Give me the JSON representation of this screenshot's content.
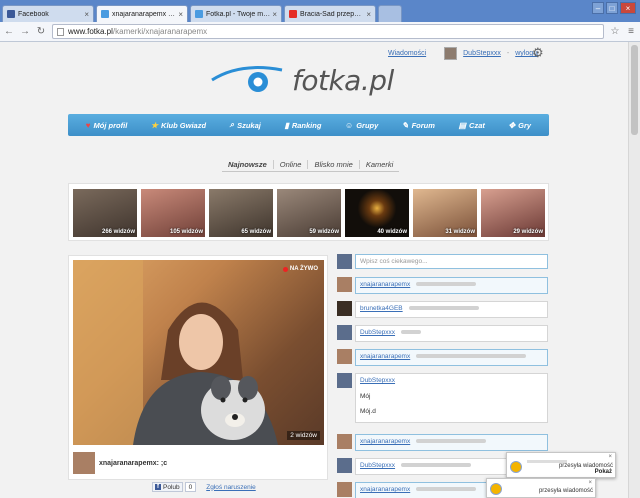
{
  "browser": {
    "tabs": [
      {
        "label": "Facebook",
        "favicon_color": "#3b5998",
        "active": false
      },
      {
        "label": "xnajaranarapemx robi transmisj",
        "favicon_color": "#4a9be0",
        "active": true
      },
      {
        "label": "Fotka.pl - Twoje miejsce w sieci",
        "favicon_color": "#4a9be0",
        "active": false
      },
      {
        "label": "Bracia-Sad przepadają + tekst",
        "favicon_color": "#e52d27",
        "active": false
      }
    ],
    "url_host": "www.fotka.pl",
    "url_path": "/kamerki/xnajaranarapemx"
  },
  "header": {
    "messages_link": "Wiadomości",
    "username": "DubStepxxx",
    "logout_link": "wyloguj",
    "logo_text": "fotka.pl"
  },
  "mainnav": [
    {
      "label": "Mój profil",
      "icon": "heart-icon"
    },
    {
      "label": "Klub Gwiazd",
      "icon": "star-icon"
    },
    {
      "label": "Szukaj",
      "icon": "search-icon"
    },
    {
      "label": "Ranking",
      "icon": "bookmark-icon"
    },
    {
      "label": "Grupy",
      "icon": "group-icon"
    },
    {
      "label": "Forum",
      "icon": "pencil-icon"
    },
    {
      "label": "Czat",
      "icon": "chat-icon"
    },
    {
      "label": "Gry",
      "icon": "gamepad-icon"
    }
  ],
  "subtabs": [
    "Najnowsze",
    "Online",
    "Blisko mnie",
    "Kamerki"
  ],
  "thumbnails": [
    {
      "viewers": "266 widzów",
      "bg": "#5b4a42"
    },
    {
      "viewers": "105 widzów",
      "bg": "#a06058"
    },
    {
      "viewers": "65 widzów",
      "bg": "#6b5d52"
    },
    {
      "viewers": "59 widzów",
      "bg": "#7c6a5e"
    },
    {
      "viewers": "40 widzów",
      "bg": "#1a1410"
    },
    {
      "viewers": "31 widzów",
      "bg": "#b89070"
    },
    {
      "viewers": "29 widzów",
      "bg": "#b07068"
    }
  ],
  "cam": {
    "live_label": "NA ŻYWO",
    "viewers_label": "2 widzów",
    "username": "xnajaranarapemx: ;c"
  },
  "social": {
    "like_label": "Polub",
    "like_count": "0",
    "report_link": "Zgłoś naruszenie"
  },
  "comments": {
    "input_placeholder": "Wpisz coś ciekawego...",
    "items": [
      {
        "user": "xnajaranarapemx",
        "highlight": true
      },
      {
        "user": "brunetka4GEB",
        "highlight": false
      },
      {
        "user": "DubStepxxx",
        "highlight": false
      },
      {
        "user": "xnajaranarapemx",
        "highlight": true
      },
      {
        "user": "DubStepxxx",
        "highlight": false,
        "lines": [
          "Mój",
          "Mój.d"
        ]
      },
      {
        "user": "xnajaranarapemx",
        "highlight": true
      },
      {
        "user": "DubStepxxx",
        "highlight": false
      },
      {
        "user": "xnajaranarapemx",
        "highlight": true
      }
    ]
  },
  "notifications": [
    {
      "text": "przesyła wiadomość",
      "button": "Pokaż"
    },
    {
      "text": "przesyła wiadomość",
      "button": "Pokaż"
    }
  ]
}
